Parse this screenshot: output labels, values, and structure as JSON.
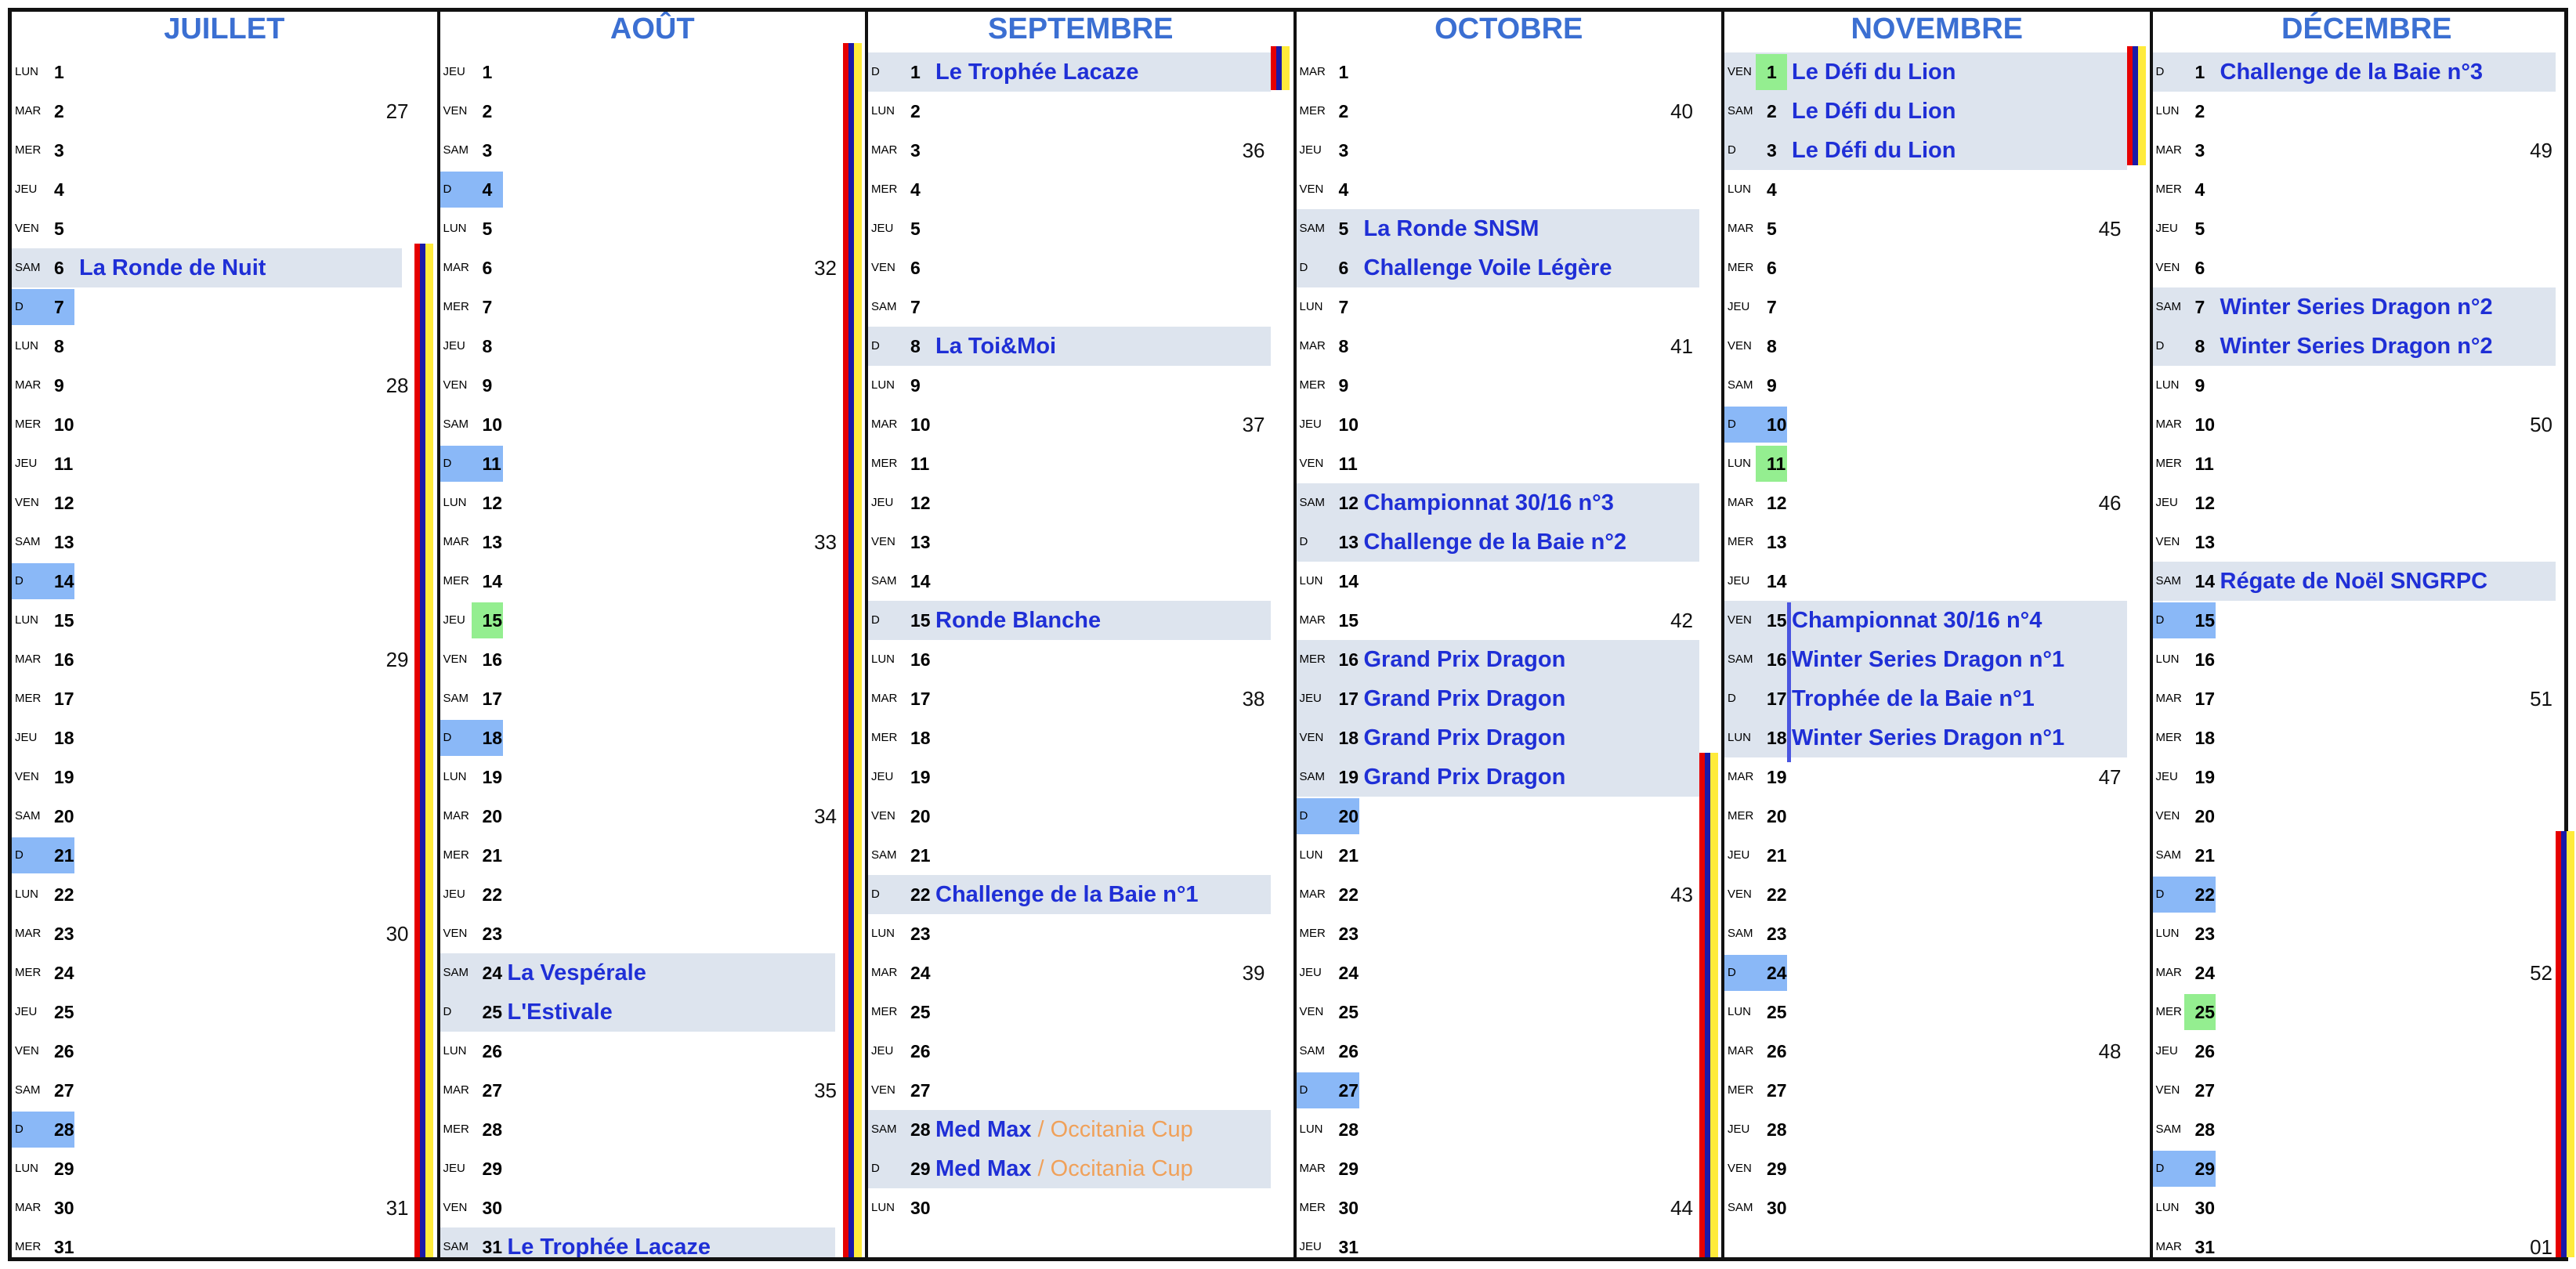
{
  "months": [
    {
      "name": "JUILLET",
      "days": [
        {
          "d": "LUN",
          "n": "1"
        },
        {
          "d": "MAR",
          "n": "2",
          "wk": "27"
        },
        {
          "d": "MER",
          "n": "3"
        },
        {
          "d": "JEU",
          "n": "4"
        },
        {
          "d": "VEN",
          "n": "5"
        },
        {
          "d": "SAM",
          "n": "6",
          "ev": "La Ronde de Nuit"
        },
        {
          "d": "D",
          "n": "7",
          "sun": true
        },
        {
          "d": "LUN",
          "n": "8"
        },
        {
          "d": "MAR",
          "n": "9",
          "wk": "28"
        },
        {
          "d": "MER",
          "n": "10"
        },
        {
          "d": "JEU",
          "n": "11"
        },
        {
          "d": "VEN",
          "n": "12"
        },
        {
          "d": "SAM",
          "n": "13"
        },
        {
          "d": "D",
          "n": "14",
          "sun": true
        },
        {
          "d": "LUN",
          "n": "15"
        },
        {
          "d": "MAR",
          "n": "16",
          "wk": "29"
        },
        {
          "d": "MER",
          "n": "17"
        },
        {
          "d": "JEU",
          "n": "18"
        },
        {
          "d": "VEN",
          "n": "19"
        },
        {
          "d": "SAM",
          "n": "20"
        },
        {
          "d": "D",
          "n": "21",
          "sun": true
        },
        {
          "d": "LUN",
          "n": "22"
        },
        {
          "d": "MAR",
          "n": "23",
          "wk": "30"
        },
        {
          "d": "MER",
          "n": "24"
        },
        {
          "d": "JEU",
          "n": "25"
        },
        {
          "d": "VEN",
          "n": "26"
        },
        {
          "d": "SAM",
          "n": "27"
        },
        {
          "d": "D",
          "n": "28",
          "sun": true
        },
        {
          "d": "LUN",
          "n": "29"
        },
        {
          "d": "MAR",
          "n": "30",
          "wk": "31"
        },
        {
          "d": "MER",
          "n": "31"
        }
      ]
    },
    {
      "name": "AOÛT",
      "days": [
        {
          "d": "JEU",
          "n": "1"
        },
        {
          "d": "VEN",
          "n": "2"
        },
        {
          "d": "SAM",
          "n": "3"
        },
        {
          "d": "D",
          "n": "4",
          "sun": true
        },
        {
          "d": "LUN",
          "n": "5"
        },
        {
          "d": "MAR",
          "n": "6",
          "wk": "32"
        },
        {
          "d": "MER",
          "n": "7"
        },
        {
          "d": "JEU",
          "n": "8"
        },
        {
          "d": "VEN",
          "n": "9"
        },
        {
          "d": "SAM",
          "n": "10"
        },
        {
          "d": "D",
          "n": "11",
          "sun": true
        },
        {
          "d": "LUN",
          "n": "12"
        },
        {
          "d": "MAR",
          "n": "13",
          "wk": "33"
        },
        {
          "d": "MER",
          "n": "14"
        },
        {
          "d": "JEU",
          "n": "15",
          "hol": true
        },
        {
          "d": "VEN",
          "n": "16"
        },
        {
          "d": "SAM",
          "n": "17"
        },
        {
          "d": "D",
          "n": "18",
          "sun": true
        },
        {
          "d": "LUN",
          "n": "19"
        },
        {
          "d": "MAR",
          "n": "20",
          "wk": "34"
        },
        {
          "d": "MER",
          "n": "21"
        },
        {
          "d": "JEU",
          "n": "22"
        },
        {
          "d": "VEN",
          "n": "23"
        },
        {
          "d": "SAM",
          "n": "24",
          "ev": "La Vespérale"
        },
        {
          "d": "D",
          "n": "25",
          "ev": "L'Estivale"
        },
        {
          "d": "LUN",
          "n": "26"
        },
        {
          "d": "MAR",
          "n": "27",
          "wk": "35"
        },
        {
          "d": "MER",
          "n": "28"
        },
        {
          "d": "JEU",
          "n": "29"
        },
        {
          "d": "VEN",
          "n": "30"
        },
        {
          "d": "SAM",
          "n": "31",
          "ev": "Le Trophée Lacaze"
        }
      ]
    },
    {
      "name": "SEPTEMBRE",
      "days": [
        {
          "d": "D",
          "n": "1",
          "ev": "Le Trophée Lacaze"
        },
        {
          "d": "LUN",
          "n": "2"
        },
        {
          "d": "MAR",
          "n": "3",
          "wk": "36"
        },
        {
          "d": "MER",
          "n": "4"
        },
        {
          "d": "JEU",
          "n": "5"
        },
        {
          "d": "VEN",
          "n": "6"
        },
        {
          "d": "SAM",
          "n": "7"
        },
        {
          "d": "D",
          "n": "8",
          "ev": "La Toi&Moi"
        },
        {
          "d": "LUN",
          "n": "9"
        },
        {
          "d": "MAR",
          "n": "10",
          "wk": "37"
        },
        {
          "d": "MER",
          "n": "11"
        },
        {
          "d": "JEU",
          "n": "12"
        },
        {
          "d": "VEN",
          "n": "13"
        },
        {
          "d": "SAM",
          "n": "14"
        },
        {
          "d": "D",
          "n": "15",
          "ev": "Ronde Blanche"
        },
        {
          "d": "LUN",
          "n": "16"
        },
        {
          "d": "MAR",
          "n": "17",
          "wk": "38"
        },
        {
          "d": "MER",
          "n": "18"
        },
        {
          "d": "JEU",
          "n": "19"
        },
        {
          "d": "VEN",
          "n": "20"
        },
        {
          "d": "SAM",
          "n": "21"
        },
        {
          "d": "D",
          "n": "22",
          "ev": "Challenge de la Baie n°1"
        },
        {
          "d": "LUN",
          "n": "23"
        },
        {
          "d": "MAR",
          "n": "24",
          "wk": "39"
        },
        {
          "d": "MER",
          "n": "25"
        },
        {
          "d": "JEU",
          "n": "26"
        },
        {
          "d": "VEN",
          "n": "27"
        },
        {
          "d": "SAM",
          "n": "28",
          "ev": "Med Max",
          "ev2": " / Occitania Cup"
        },
        {
          "d": "D",
          "n": "29",
          "ev": "Med Max",
          "ev2": " / Occitania Cup"
        },
        {
          "d": "LUN",
          "n": "30"
        }
      ]
    },
    {
      "name": "OCTOBRE",
      "days": [
        {
          "d": "MAR",
          "n": "1"
        },
        {
          "d": "MER",
          "n": "2",
          "wk": "40"
        },
        {
          "d": "JEU",
          "n": "3"
        },
        {
          "d": "VEN",
          "n": "4"
        },
        {
          "d": "SAM",
          "n": "5",
          "ev": "La Ronde SNSM"
        },
        {
          "d": "D",
          "n": "6",
          "ev": "Challenge Voile Légère"
        },
        {
          "d": "LUN",
          "n": "7"
        },
        {
          "d": "MAR",
          "n": "8",
          "wk": "41"
        },
        {
          "d": "MER",
          "n": "9"
        },
        {
          "d": "JEU",
          "n": "10"
        },
        {
          "d": "VEN",
          "n": "11"
        },
        {
          "d": "SAM",
          "n": "12",
          "ev": "Championnat 30/16 n°3"
        },
        {
          "d": "D",
          "n": "13",
          "ev": "Challenge de la Baie n°2"
        },
        {
          "d": "LUN",
          "n": "14"
        },
        {
          "d": "MAR",
          "n": "15",
          "wk": "42"
        },
        {
          "d": "MER",
          "n": "16",
          "ev": "Grand Prix Dragon"
        },
        {
          "d": "JEU",
          "n": "17",
          "ev": "Grand Prix Dragon"
        },
        {
          "d": "VEN",
          "n": "18",
          "ev": "Grand Prix Dragon"
        },
        {
          "d": "SAM",
          "n": "19",
          "ev": "Grand Prix Dragon"
        },
        {
          "d": "D",
          "n": "20",
          "sun": true
        },
        {
          "d": "LUN",
          "n": "21"
        },
        {
          "d": "MAR",
          "n": "22",
          "wk": "43"
        },
        {
          "d": "MER",
          "n": "23"
        },
        {
          "d": "JEU",
          "n": "24"
        },
        {
          "d": "VEN",
          "n": "25"
        },
        {
          "d": "SAM",
          "n": "26"
        },
        {
          "d": "D",
          "n": "27",
          "sun": true
        },
        {
          "d": "LUN",
          "n": "28"
        },
        {
          "d": "MAR",
          "n": "29"
        },
        {
          "d": "MER",
          "n": "30",
          "wk": "44"
        },
        {
          "d": "JEU",
          "n": "31"
        }
      ]
    },
    {
      "name": "NOVEMBRE",
      "days": [
        {
          "d": "VEN",
          "n": "1",
          "hol": true,
          "ev": "Le Défi du Lion"
        },
        {
          "d": "SAM",
          "n": "2",
          "ev": "Le Défi du Lion"
        },
        {
          "d": "D",
          "n": "3",
          "ev": "Le Défi du Lion"
        },
        {
          "d": "LUN",
          "n": "4"
        },
        {
          "d": "MAR",
          "n": "5",
          "wk": "45"
        },
        {
          "d": "MER",
          "n": "6"
        },
        {
          "d": "JEU",
          "n": "7"
        },
        {
          "d": "VEN",
          "n": "8"
        },
        {
          "d": "SAM",
          "n": "9"
        },
        {
          "d": "D",
          "n": "10",
          "sun": true
        },
        {
          "d": "LUN",
          "n": "11",
          "hol": true
        },
        {
          "d": "MAR",
          "n": "12",
          "wk": "46"
        },
        {
          "d": "MER",
          "n": "13"
        },
        {
          "d": "JEU",
          "n": "14"
        },
        {
          "d": "VEN",
          "n": "15",
          "ev": "Championnat 30/16 n°4"
        },
        {
          "d": "SAM",
          "n": "16",
          "ev": "Winter Series Dragon n°1"
        },
        {
          "d": "D",
          "n": "17",
          "ev": "Trophée de la Baie n°1"
        },
        {
          "d": "LUN",
          "n": "18",
          "ev": "Winter Series Dragon n°1"
        },
        {
          "d": "MAR",
          "n": "19",
          "wk": "47"
        },
        {
          "d": "MER",
          "n": "20"
        },
        {
          "d": "JEU",
          "n": "21"
        },
        {
          "d": "VEN",
          "n": "22"
        },
        {
          "d": "SAM",
          "n": "23"
        },
        {
          "d": "D",
          "n": "24",
          "sun": true
        },
        {
          "d": "LUN",
          "n": "25"
        },
        {
          "d": "MAR",
          "n": "26",
          "wk": "48"
        },
        {
          "d": "MER",
          "n": "27"
        },
        {
          "d": "JEU",
          "n": "28"
        },
        {
          "d": "VEN",
          "n": "29"
        },
        {
          "d": "SAM",
          "n": "30"
        }
      ]
    },
    {
      "name": "DÉCEMBRE",
      "days": [
        {
          "d": "D",
          "n": "1",
          "ev": "Challenge de la Baie n°3"
        },
        {
          "d": "LUN",
          "n": "2"
        },
        {
          "d": "MAR",
          "n": "3",
          "wk": "49"
        },
        {
          "d": "MER",
          "n": "4"
        },
        {
          "d": "JEU",
          "n": "5"
        },
        {
          "d": "VEN",
          "n": "6"
        },
        {
          "d": "SAM",
          "n": "7",
          "ev": "Winter Series Dragon n°2"
        },
        {
          "d": "D",
          "n": "8",
          "ev": "Winter Series Dragon n°2"
        },
        {
          "d": "LUN",
          "n": "9"
        },
        {
          "d": "MAR",
          "n": "10",
          "wk": "50"
        },
        {
          "d": "MER",
          "n": "11"
        },
        {
          "d": "JEU",
          "n": "12"
        },
        {
          "d": "VEN",
          "n": "13"
        },
        {
          "d": "SAM",
          "n": "14",
          "ev": "Régate de Noël SNGRPC"
        },
        {
          "d": "D",
          "n": "15",
          "sun": true
        },
        {
          "d": "LUN",
          "n": "16"
        },
        {
          "d": "MAR",
          "n": "17",
          "wk": "51"
        },
        {
          "d": "MER",
          "n": "18"
        },
        {
          "d": "JEU",
          "n": "19"
        },
        {
          "d": "VEN",
          "n": "20"
        },
        {
          "d": "SAM",
          "n": "21"
        },
        {
          "d": "D",
          "n": "22",
          "sun": true
        },
        {
          "d": "LUN",
          "n": "23"
        },
        {
          "d": "MAR",
          "n": "24",
          "wk": "52"
        },
        {
          "d": "MER",
          "n": "25",
          "hol": true
        },
        {
          "d": "JEU",
          "n": "26"
        },
        {
          "d": "VEN",
          "n": "27"
        },
        {
          "d": "SAM",
          "n": "28"
        },
        {
          "d": "D",
          "n": "29",
          "sun": true
        },
        {
          "d": "LUN",
          "n": "30"
        },
        {
          "d": "MAR",
          "n": "31",
          "wk": "01"
        }
      ]
    }
  ],
  "colors": {
    "title": "#3b6fd2",
    "event": "#1f2fd6",
    "event_secondary": "#f0a15a",
    "event_row": "#dde4ee",
    "sunday": "#8ab8f7",
    "holiday": "#94ee90",
    "stripe_red": "#e60000",
    "stripe_blue": "#1a1aa8",
    "stripe_yellow": "#ffeb3b"
  }
}
